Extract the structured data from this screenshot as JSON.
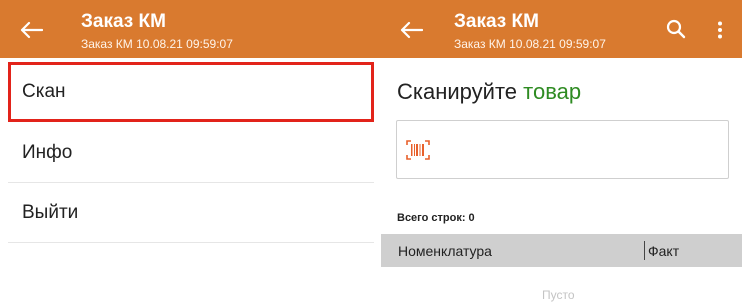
{
  "left_screen": {
    "appbar": {
      "title": "Заказ КМ",
      "subtitle": "Заказ КМ 10.08.21 09:59:07"
    },
    "menu": [
      {
        "label": "Скан",
        "highlighted": true
      },
      {
        "label": "Инфо",
        "highlighted": false
      },
      {
        "label": "Выйти",
        "highlighted": false
      }
    ]
  },
  "right_screen": {
    "appbar": {
      "title": "Заказ КМ",
      "subtitle": "Заказ КМ 10.08.21 09:59:07"
    },
    "prompt": {
      "prefix": "Сканируйте ",
      "accent": "товар"
    },
    "rows_count_label": "Всего строк: 0",
    "table": {
      "columns": [
        "Номенклатура",
        "Факт"
      ]
    },
    "empty_text": "Пусто"
  },
  "icons": {
    "back": "arrow-left-icon",
    "search": "search-icon",
    "more": "more-vertical-icon",
    "barcode": "barcode-icon"
  },
  "colors": {
    "appbar": "#d97a2f",
    "highlight_border": "#e2231a",
    "prompt_accent": "#2e8b22",
    "barcode_icon": "#e8612c",
    "table_header": "#cfcfcf"
  }
}
